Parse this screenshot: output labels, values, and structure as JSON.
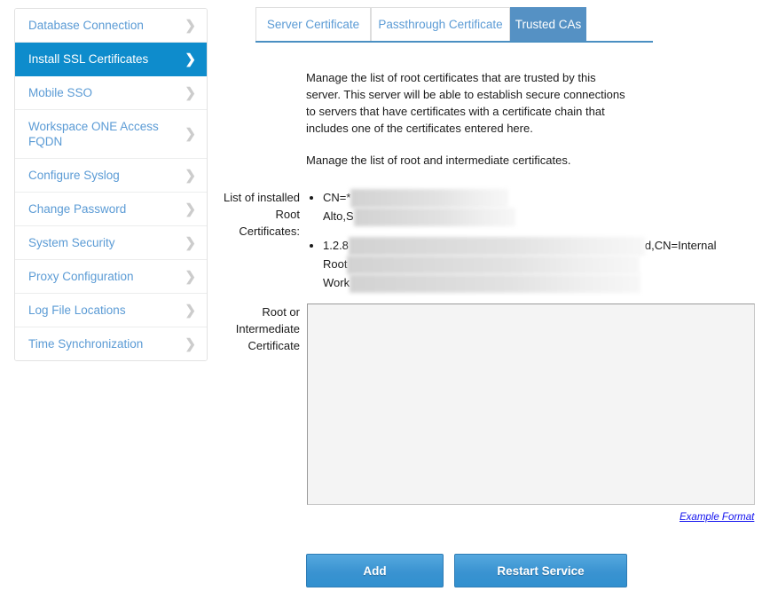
{
  "sidebar": {
    "items": [
      {
        "label": "Database Connection",
        "active": false,
        "icon": "chevron-right-icon"
      },
      {
        "label": "Install SSL Certificates",
        "active": true,
        "icon": "chevron-right-icon"
      },
      {
        "label": "Mobile SSO",
        "active": false,
        "icon": "chevron-right-icon"
      },
      {
        "label": "Workspace ONE Access FQDN",
        "active": false,
        "icon": "chevron-right-icon"
      },
      {
        "label": "Configure Syslog",
        "active": false,
        "icon": "chevron-right-icon"
      },
      {
        "label": "Change Password",
        "active": false,
        "icon": "chevron-right-icon"
      },
      {
        "label": "System Security",
        "active": false,
        "icon": "chevron-right-icon"
      },
      {
        "label": "Proxy Configuration",
        "active": false,
        "icon": "chevron-right-icon"
      },
      {
        "label": "Log File Locations",
        "active": false,
        "icon": "chevron-right-icon"
      },
      {
        "label": "Time Synchronization",
        "active": false,
        "icon": "chevron-right-icon"
      }
    ]
  },
  "tabs": [
    {
      "label": "Server Certificate",
      "active": false
    },
    {
      "label": "Passthrough Certificate",
      "active": false
    },
    {
      "label": "Trusted CAs",
      "active": true
    }
  ],
  "description": {
    "paragraph1": "Manage the list of root certificates that are trusted by this server. This server will be able to establish secure connections to servers that have certificates with a certificate chain that includes one of the certificates entered here.",
    "paragraph2": "Manage the list of root and intermediate certificates."
  },
  "root_certificates": {
    "label": "List of installed Root Certificates:",
    "items": [
      {
        "visible_prefix": "CN=*",
        "visible_continuation": "Alto,S",
        "redacted": true
      },
      {
        "visible_prefix": "1.2.8",
        "visible_suffix": "d,CN=Internal",
        "visible_continuation_1": "Root",
        "visible_continuation_2": "Work",
        "redacted": true
      }
    ]
  },
  "certificate_input": {
    "label": "Root or Intermediate Certificate",
    "value": "",
    "placeholder": ""
  },
  "example_format_link": "Example Format",
  "buttons": {
    "add": "Add",
    "restart": "Restart Service"
  },
  "colors": {
    "sidebar_active": "#0e8ccc",
    "tab_active": "#5591c4",
    "tab_text": "#5b9bd5",
    "button_blue": "#3a93d1",
    "link_blue": "#1111ee"
  }
}
